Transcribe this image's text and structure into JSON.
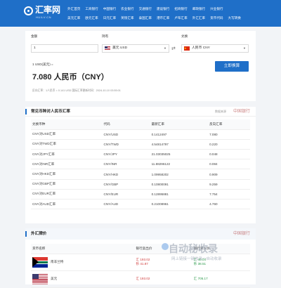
{
  "header": {
    "logo_text": "汇率网",
    "logo_sub": "HUILV.CN",
    "nav_row1": [
      "外汇首页",
      "工商银行",
      "中国银行",
      "农业银行",
      "交通银行",
      "建设银行",
      "招商银行",
      "邮政银行",
      "兴业银行"
    ],
    "nav_row2": [
      "美元汇率",
      "欧元汇率",
      "日元汇率",
      "英镑汇率",
      "泰国汇率",
      "港币汇率",
      "卢布汇率",
      "外汇汇率",
      "货币代码",
      "大写转换"
    ]
  },
  "converter": {
    "amount_label": "金额",
    "amount_value": "1",
    "hold_label": "持有",
    "hold_value": "美元 USD",
    "exchange_label": "兑换",
    "exchange_value": "人民币 CNY",
    "button_label": "立即换算",
    "rate_small": "1 USD(美元) =",
    "rate_big": "7.080 人民币（CNY）",
    "rate_note": "反向汇率：1人民币 = 0.141 USD  国际汇率更新时间：2024-10-10 03:55:01"
  },
  "rates_table": {
    "title": "常见币种对人民币汇率",
    "caption": "数据来源",
    "logo": "中国银行",
    "headers": [
      "兑换币种",
      "代码",
      "最新汇率",
      "反向汇率"
    ],
    "rows": [
      [
        "CNY对USD汇率",
        "CNY/USD",
        "0.1412497",
        "7.080"
      ],
      [
        "CNY对TWD汇率",
        "CNY/TWD",
        "4.54814797",
        "0.220"
      ],
      [
        "CNY对JPY汇率",
        "CNY/JPY",
        "21.03035025",
        "0.048"
      ],
      [
        "CNY对INR汇率",
        "CNY/INR",
        "11.88296122",
        "0.084"
      ],
      [
        "CNY对HKD汇率",
        "CNY/HKD",
        "1.09958202",
        "0.909"
      ],
      [
        "CNY对GBP汇率",
        "CNY/GBP",
        "0.10800091",
        "9.259"
      ],
      [
        "CNY对EUR汇率",
        "CNY/EUR",
        "0.12895881",
        "7.754"
      ],
      [
        "CNY对AUD汇率",
        "CNY/AUD",
        "0.21008961",
        "4.760"
      ]
    ]
  },
  "fx_table": {
    "title": "外汇牌价",
    "logo": "中国银行",
    "headers": [
      "货币名称",
      "银行卖出价",
      "银行买入价"
    ],
    "rows": [
      {
        "flag": "za",
        "name": "南非兰特",
        "sell1": "汇 193.02",
        "sell2": "钞 41.87",
        "buy1": "汇 40.04",
        "buy2": "钞 38.51"
      },
      {
        "flag": "us",
        "name": "美元",
        "sell1": "汇 193.02",
        "sell2": "",
        "buy1": "汇 705.17",
        "buy2": ""
      }
    ]
  },
  "watermark": {
    "big": "自动秘收录",
    "small": "网上链接一键收录一自动收录"
  }
}
